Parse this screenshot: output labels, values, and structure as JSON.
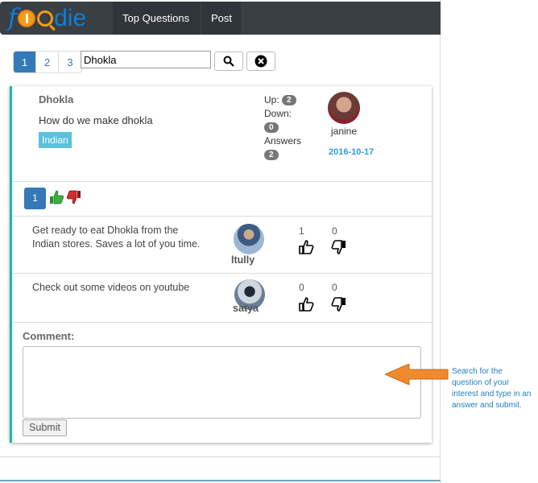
{
  "brand": {
    "logo_text_f": "f",
    "logo_text_rest": "die"
  },
  "nav": {
    "items": [
      {
        "label": "Top Questions"
      },
      {
        "label": "Post"
      }
    ]
  },
  "search": {
    "pages": [
      "1",
      "2",
      "3"
    ],
    "active_page": "1",
    "query": "Dhokla"
  },
  "question": {
    "title": "Dhokla",
    "body": "How do we make dhokla",
    "tag": "Indian",
    "up_label": "Up:",
    "up_count": "2",
    "down_label": "Down:",
    "down_count": "0",
    "answers_label": "Answers",
    "answers_count": "2",
    "user": "janine",
    "date": "2016-10-17"
  },
  "answers_pager": {
    "page": "1"
  },
  "answers": [
    {
      "text": "Get ready to eat Dhokla from the Indian stores. Saves a lot of you time.",
      "user": "ltully",
      "up": "1",
      "down": "0"
    },
    {
      "text": "Check out some videos on youtube",
      "user": "satya",
      "up": "0",
      "down": "0"
    }
  ],
  "comment": {
    "label": "Comment:",
    "submit_label": "Submit"
  },
  "annotation": {
    "text": "Search for the question of your interest and type in an answer and submit."
  },
  "colors": {
    "navbar": "#3a3f44",
    "brand": "#0e7fd8",
    "accent": "#1abc9c",
    "primary": "#337ab7",
    "tag": "#5bc0de",
    "date": "#2a9fd6",
    "arrow": "#f08a2e",
    "note": "#1e7fbf"
  }
}
